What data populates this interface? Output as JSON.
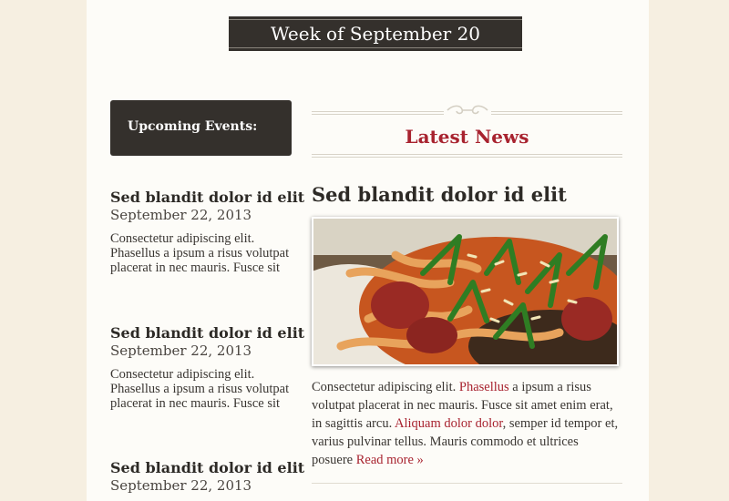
{
  "header": {
    "week_label": "Week of September 20"
  },
  "sidebar": {
    "heading": "Upcoming Events:",
    "events": [
      {
        "title": "Sed blandit dolor id elit",
        "date": "September 22, 2013",
        "body": "Consectetur adipiscing elit. Phasellus a ipsum a risus volutpat placerat in nec mauris. Fusce sit"
      },
      {
        "title": "Sed blandit dolor id elit",
        "date": "September 22, 2013",
        "body": "Consectetur adipiscing elit. Phasellus a ipsum a risus volutpat placerat in nec mauris. Fusce sit"
      },
      {
        "title": "Sed blandit dolor id elit",
        "date": "September 22, 2013",
        "body": ""
      }
    ]
  },
  "main": {
    "section_title": "Latest News",
    "article": {
      "title": "Sed blandit dolor id elit",
      "image_icon": "pasta-photo-icon",
      "body_1": "Consectetur adipiscing elit. ",
      "link_1": "Phasellus",
      "body_2": " a ipsum a risus volutpat placerat in nec mauris. Fusce sit amet enim erat, in sagittis arcu. ",
      "link_2": "Aliquam dolor dolor",
      "body_3": ", semper id tempor et, varius pulvinar tellus. Mauris commodo et ultrices posuere ",
      "read_more": "Read more »"
    }
  },
  "colors": {
    "accent": "#a8232f",
    "dark_box": "#34302c",
    "page_bg": "#fdfcf8",
    "outer_bg": "#f6efe1"
  }
}
